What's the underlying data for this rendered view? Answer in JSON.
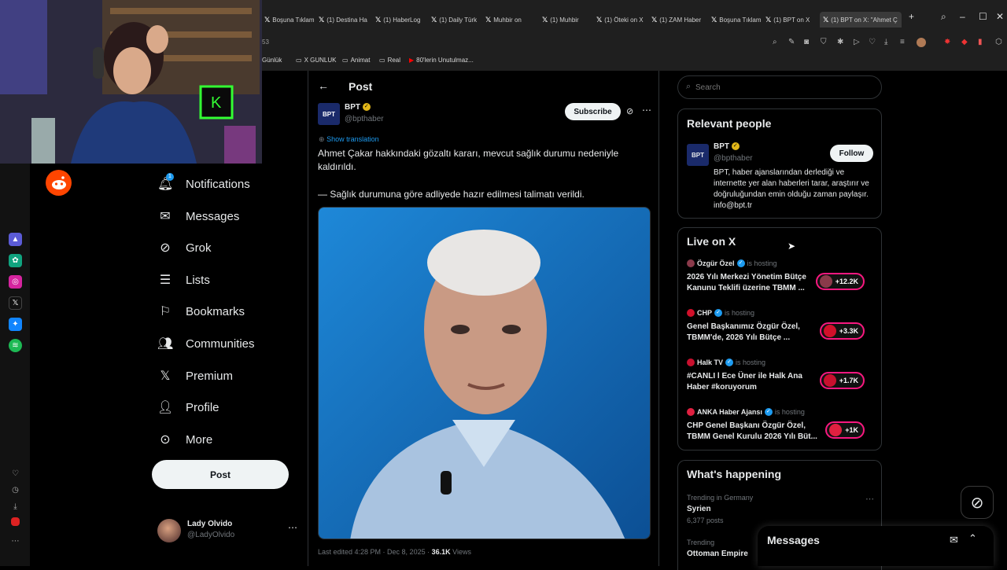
{
  "browser": {
    "tabs": [
      {
        "label": "Boşuna Tıklam",
        "icon": "x-icon"
      },
      {
        "label": "(1) Destina Ha",
        "icon": "x-icon"
      },
      {
        "label": "(1) HaberLog",
        "icon": "x-icon"
      },
      {
        "label": "(1) Daily Türk",
        "icon": "x-icon"
      },
      {
        "label": "Muhbir on",
        "icon": "x-icon"
      },
      {
        "label": "(1) Muhbir",
        "icon": "x-icon"
      },
      {
        "label": "(1) Öteki on X",
        "icon": "x-icon"
      },
      {
        "label": "(1) ZAM Haber",
        "icon": "x-icon"
      },
      {
        "label": "Boşuna Tıklam",
        "icon": "x-icon"
      },
      {
        "label": "(1) BPT on X",
        "icon": "x-icon"
      },
      {
        "label": "(1) BPT on X: \"Ahmet Ç",
        "icon": "x-icon"
      }
    ],
    "address_fragment": "53",
    "bookmarks": [
      "Günlük",
      "X GUNLUK",
      "Animat",
      "Real",
      "80'lerin Unutulmaz..."
    ]
  },
  "nav": {
    "items": [
      {
        "label": "Notifications",
        "icon": "bell-icon",
        "badge": "1"
      },
      {
        "label": "Messages",
        "icon": "envelope-icon"
      },
      {
        "label": "Grok",
        "icon": "grok-icon"
      },
      {
        "label": "Lists",
        "icon": "list-icon"
      },
      {
        "label": "Bookmarks",
        "icon": "bookmark-icon"
      },
      {
        "label": "Communities",
        "icon": "people-icon"
      },
      {
        "label": "Premium",
        "icon": "x-logo-icon"
      },
      {
        "label": "Profile",
        "icon": "person-icon"
      },
      {
        "label": "More",
        "icon": "more-circle-icon"
      }
    ],
    "post_button": "Post",
    "account": {
      "name": "Lady Olvido",
      "handle": "@LadyOlvido"
    }
  },
  "post": {
    "header": "Post",
    "author_name": "BPT",
    "author_handle": "@bpthaber",
    "avatar_text": "BPT",
    "subscribe": "Subscribe",
    "show_translation": "Show translation",
    "text_line1": "Ahmet Çakar hakkındaki gözaltı kararı, mevcut sağlık durumu nedeniyle kaldırıldı.",
    "text_line2": "— Sağlık durumuna göre adliyede hazır edilmesi talimatı verildi.",
    "meta": "Last edited 4:28 PM · Dec 8, 2025 · ",
    "views": "36.1K",
    "views_label": " Views"
  },
  "right": {
    "search_placeholder": "Search",
    "relevant": {
      "title": "Relevant people",
      "name": "BPT",
      "handle": "@bpthaber",
      "follow": "Follow",
      "bio": "BPT, haber ajanslarından derlediği ve internette yer alan haberleri tarar, araştırır ve doğruluğundan emin olduğu zaman paylaşır. info@bpt.tr"
    },
    "live": {
      "title": "Live on X",
      "hosting_label": "is hosting",
      "items": [
        {
          "host": "Özgür Özel",
          "title": "2026 Yılı Merkezi Yönetim Bütçe Kanunu Teklifi üzerine TBMM ...",
          "count": "+12.2K",
          "color": "#8a3a4a"
        },
        {
          "host": "CHP",
          "title": "Genel Başkanımız Özgür Özel, TBMM'de, 2026 Yılı Bütçe ...",
          "count": "+3.3K",
          "color": "#d0102a"
        },
        {
          "host": "Halk TV",
          "title": "#CANLI l Ece Üner ile Halk Ana Haber #koruyorum",
          "count": "+1.7K",
          "color": "#c8102e"
        },
        {
          "host": "ANKA Haber Ajansı",
          "title": "CHP Genel Başkanı Özgür Özel, TBMM Genel Kurulu 2026 Yılı Büt...",
          "count": "+1K",
          "color": "#e02040"
        }
      ]
    },
    "happening": {
      "title": "What's happening",
      "items": [
        {
          "context": "Trending in Germany",
          "topic": "Syrien",
          "posts": "6,377 posts"
        },
        {
          "context": "Trending",
          "topic": "Ottoman Empire",
          "posts": ""
        }
      ]
    },
    "messages_drawer": "Messages"
  },
  "colors": {
    "accent": "#1d9bf0",
    "live": "#f91880",
    "verified_gold": "#e2b719"
  }
}
